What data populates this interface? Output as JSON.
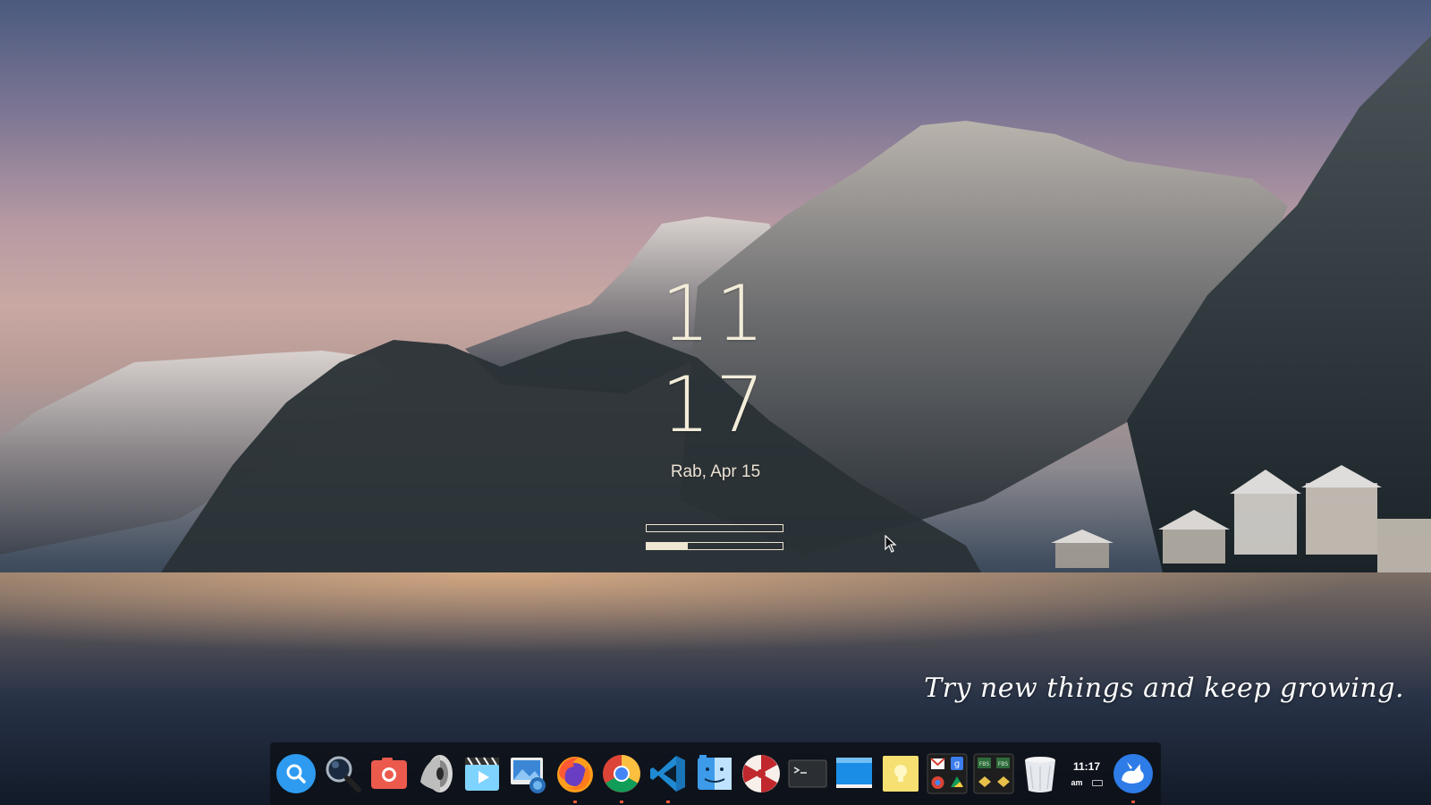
{
  "clock": {
    "hour": "11",
    "minute": "17",
    "date": "Rab, Apr 15",
    "meters": [
      {
        "name": "meter-1",
        "level": 0.0
      },
      {
        "name": "meter-2",
        "level": 0.3
      }
    ]
  },
  "quote": "Try new things and keep growing.",
  "dock": {
    "items": [
      {
        "name": "search-icon",
        "label": "Search",
        "running": false
      },
      {
        "name": "magnifier-icon",
        "label": "Magnifier",
        "running": false
      },
      {
        "name": "camera-icon",
        "label": "Screenshot",
        "running": false
      },
      {
        "name": "speaker-icon",
        "label": "Sound",
        "running": false
      },
      {
        "name": "video-player-icon",
        "label": "Video Player",
        "running": false
      },
      {
        "name": "image-viewer-icon",
        "label": "Image Viewer",
        "running": false
      },
      {
        "name": "firefox-icon",
        "label": "Firefox",
        "running": true
      },
      {
        "name": "chrome-icon",
        "label": "Chrome",
        "running": true
      },
      {
        "name": "vscode-icon",
        "label": "Visual Studio Code",
        "running": true
      },
      {
        "name": "file-manager-icon",
        "label": "Files",
        "running": false
      },
      {
        "name": "peppermint-icon",
        "label": "Peppermint",
        "running": false
      },
      {
        "name": "terminal-icon",
        "label": "Terminal",
        "running": false
      },
      {
        "name": "desktop-icon",
        "label": "Show Desktop",
        "running": false
      },
      {
        "name": "bulb-icon",
        "label": "Ideas",
        "running": false
      },
      {
        "name": "google-apps-icon",
        "label": "Google Apps",
        "running": false
      },
      {
        "name": "fbs-icon",
        "label": "FBS",
        "running": false
      },
      {
        "name": "trash-icon",
        "label": "Trash",
        "running": false
      }
    ],
    "tray": {
      "time": "11:17",
      "meridiem": "am"
    },
    "launcher": {
      "name": "launcher-icon",
      "running": true
    }
  },
  "colors": {
    "accent": "#2e9bf0",
    "run_indicator": "#ff5a3a",
    "clock_text": "#f2ecd9"
  }
}
